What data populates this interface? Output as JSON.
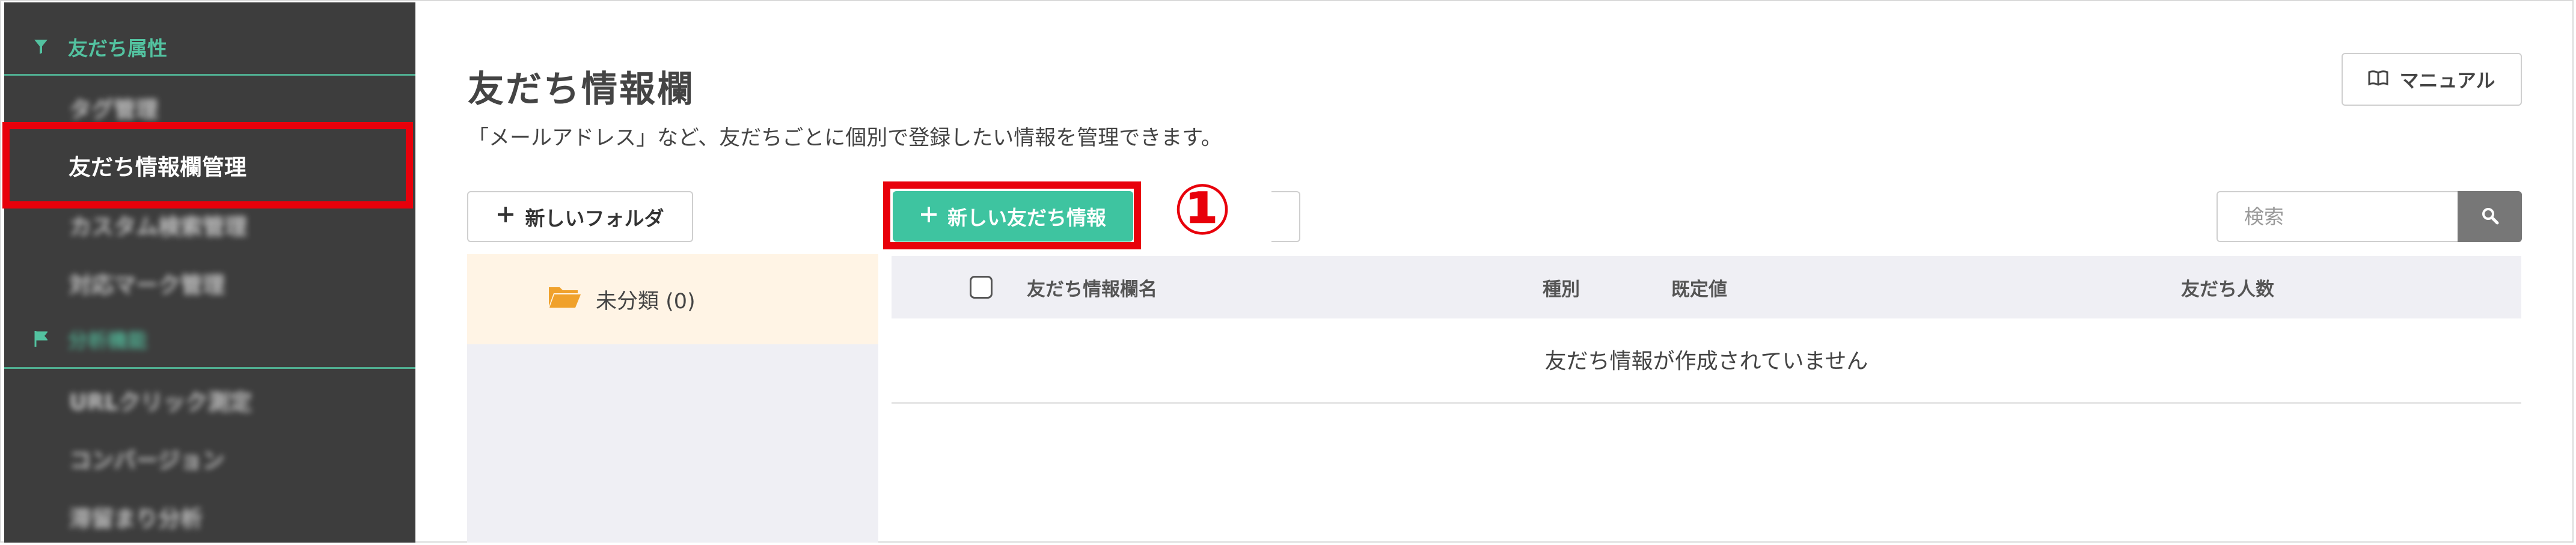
{
  "sidebar": {
    "section_friend_attrs": "友だち属性",
    "items": [
      {
        "label": "タグ管理",
        "blurred": true
      },
      {
        "label": "友だち情報欄管理",
        "active": true
      },
      {
        "label": "カスタム検索管理",
        "blurred": true
      },
      {
        "label": "対応マーク管理",
        "blurred": true
      }
    ],
    "section_analysis": "分析機能",
    "analysis_items": [
      {
        "label": "URLクリック測定",
        "blurred": true
      },
      {
        "label": "コンバージョン",
        "blurred": true
      },
      {
        "label": "滞留まり分析",
        "blurred": true
      }
    ]
  },
  "main": {
    "title": "友だち情報欄",
    "description": "「メールアドレス」など、友だちごとに個別で登録したい情報を管理できます。",
    "manual_label": "マニュアル",
    "new_folder_label": "新しいフォルダ",
    "new_info_label": "新しい友だち情報",
    "annotation_number": "①",
    "search_placeholder": "検索",
    "folder": {
      "name": "未分類 (0)"
    },
    "table": {
      "columns": [
        "友だち情報欄名",
        "種別",
        "既定値",
        "友だち人数"
      ],
      "empty_message": "友だち情報が作成されていません"
    }
  },
  "colors": {
    "sidebar_bg": "#3d3d3d",
    "accent_green": "#3ec4a0",
    "highlight_red": "#e8000b",
    "folder_row_bg": "#fff4e5",
    "folder_icon": "#f0a12b"
  },
  "icons": {
    "filter": "filter-icon",
    "flag": "flag-icon",
    "book": "book-icon",
    "plus": "plus-icon",
    "folder": "folder-icon",
    "search": "search-icon"
  }
}
